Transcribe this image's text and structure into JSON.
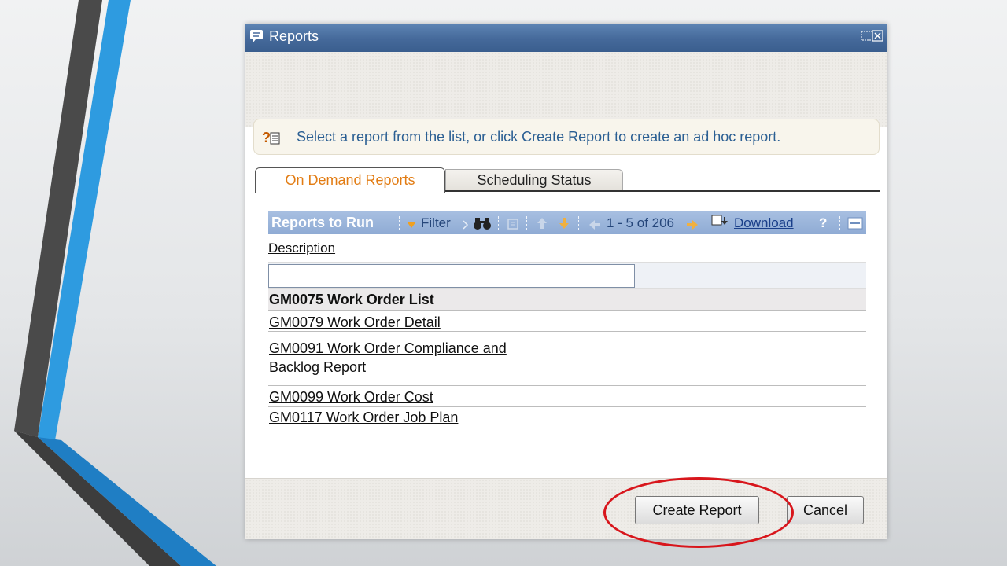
{
  "dialog": {
    "title": "Reports",
    "info_text": "Select a report from the list, or click Create Report to create an ad hoc report."
  },
  "tabs": [
    {
      "label": "On Demand Reports",
      "active": true
    },
    {
      "label": "Scheduling Status",
      "active": false
    }
  ],
  "toolbar": {
    "title": "Reports to Run",
    "filter_label": "Filter",
    "paging_text": "1 - 5 of 206",
    "download_label": "Download",
    "help_label": "?"
  },
  "table": {
    "column_header": "Description",
    "filter_value": "",
    "rows": [
      {
        "label": "GM0075 Work Order List"
      },
      {
        "label": "GM0079 Work Order Detail"
      },
      {
        "label": "GM0091 Work Order Compliance and Backlog Report"
      },
      {
        "label": "GM0099 Work Order Cost"
      },
      {
        "label": "GM0117 Work Order Job Plan"
      }
    ]
  },
  "buttons": {
    "create_report": "Create Report",
    "cancel": "Cancel"
  },
  "colors": {
    "titlebar": "#45699a",
    "toolbar": "#8fabd4",
    "active_tab_text": "#e27c13",
    "highlight_ring": "#d8161c",
    "info_text": "#2b5f93"
  }
}
